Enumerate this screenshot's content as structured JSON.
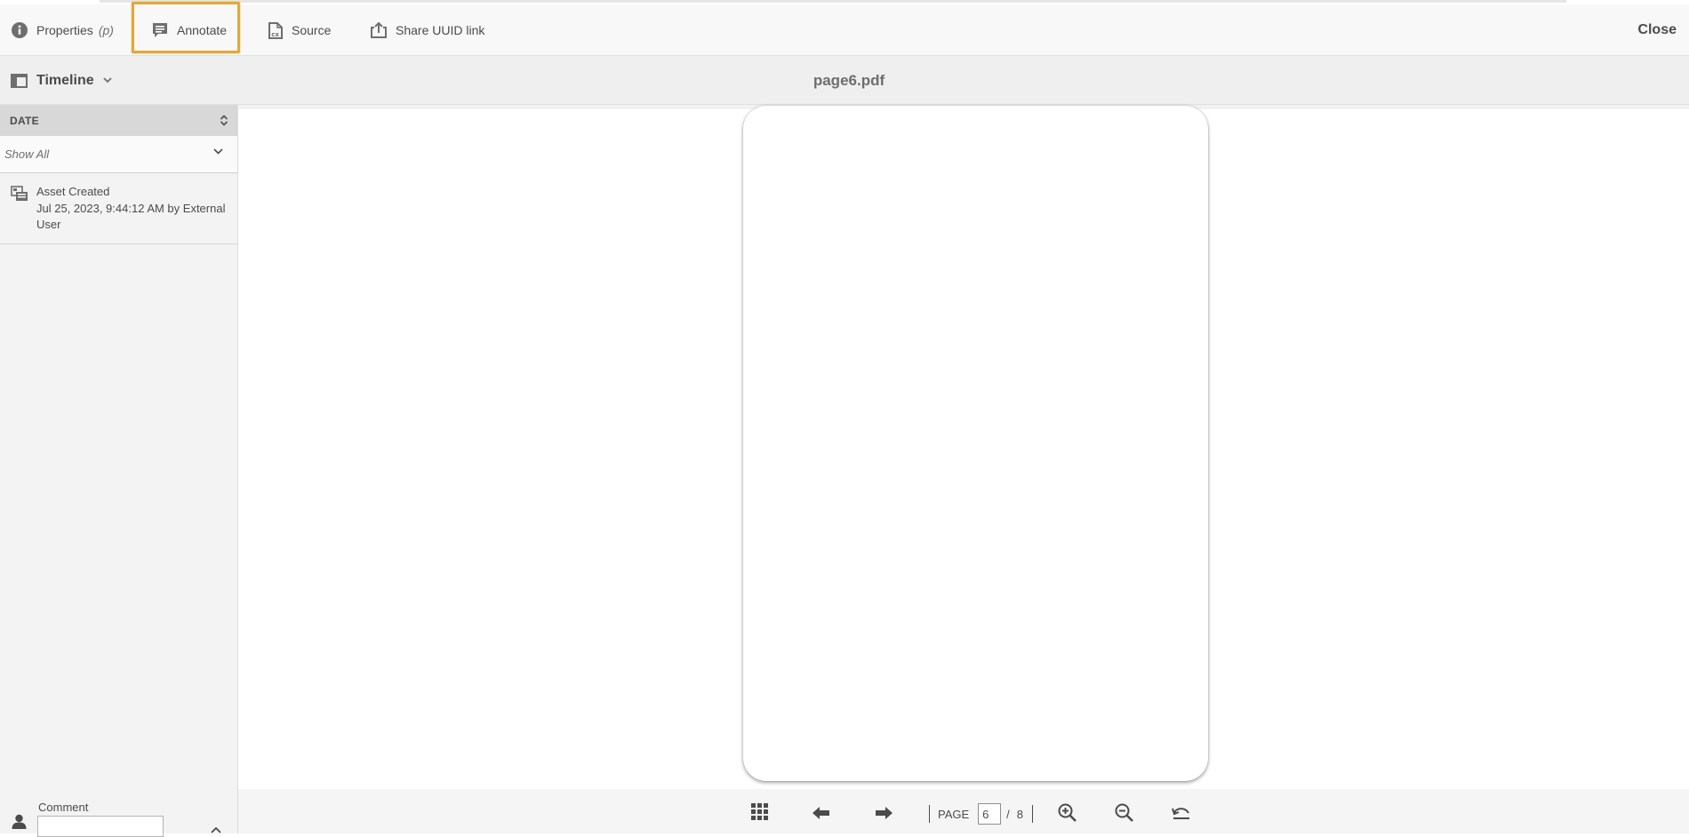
{
  "toolbar": {
    "properties_label": "Properties",
    "properties_shortcut": "(p)",
    "annotate_label": "Annotate",
    "source_label": "Source",
    "share_label": "Share UUID link",
    "close_label": "Close",
    "highlight_color": "#e1a93a"
  },
  "header": {
    "rail_selector_label": "Timeline",
    "file_title": "page6.pdf"
  },
  "timeline": {
    "section_label": "DATE",
    "filter_value": "Show All",
    "events": [
      {
        "title": "Asset Created",
        "detail": "Jul 25, 2023, 9:44:12 AM by External User"
      }
    ],
    "comment_label": "Comment",
    "comment_value": ""
  },
  "pager": {
    "label": "PAGE",
    "current": "6",
    "separator": "/",
    "total": "8"
  },
  "icons": {
    "properties": "info-icon",
    "annotate": "comment-icon",
    "source": "document-source-icon",
    "share": "share-icon",
    "rail": "rail-panel-icon",
    "event": "asset-created-icon",
    "user": "user-icon",
    "grid": "grid-icon",
    "prev": "arrow-left-icon",
    "next": "arrow-right-icon",
    "zoom_in": "zoom-in-icon",
    "zoom_out": "zoom-out-icon",
    "reset": "reset-icon"
  }
}
